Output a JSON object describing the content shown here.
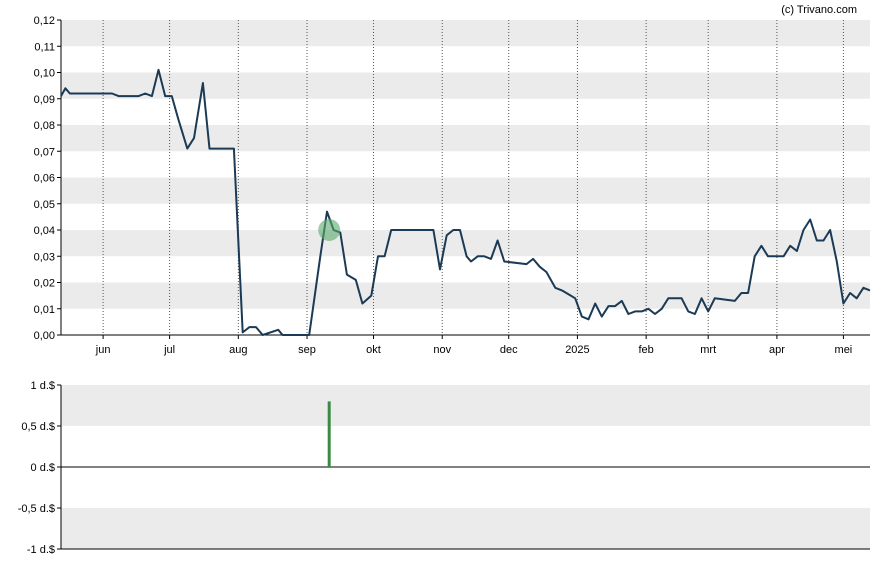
{
  "credit": "(c) Trivano.com",
  "colors": {
    "price_line": "#1b3a55",
    "band": "#ebebeb",
    "volume_bar": "#3a8a45",
    "marker_fill": "#5aaa6a",
    "axis": "#000000",
    "vgrid": "#555555"
  },
  "chart_data": [
    {
      "type": "line",
      "title": "",
      "xlabel": "",
      "ylabel": "",
      "ylim": [
        0,
        0.12
      ],
      "y_ticks": [
        "0,00",
        "0,01",
        "0,02",
        "0,03",
        "0,04",
        "0,05",
        "0,06",
        "0,07",
        "0,08",
        "0,09",
        "0,10",
        "0,11",
        "0,12"
      ],
      "x_range": [
        "2024-05-13",
        "2025-05-13"
      ],
      "x_ticks": [
        {
          "label": "jun",
          "date": "2024-06-01"
        },
        {
          "label": "jul",
          "date": "2024-07-01"
        },
        {
          "label": "aug",
          "date": "2024-08-01"
        },
        {
          "label": "sep",
          "date": "2024-09-01"
        },
        {
          "label": "okt",
          "date": "2024-10-01"
        },
        {
          "label": "nov",
          "date": "2024-11-01"
        },
        {
          "label": "dec",
          "date": "2024-12-01"
        },
        {
          "label": "2025",
          "date": "2025-01-01"
        },
        {
          "label": "feb",
          "date": "2025-02-01"
        },
        {
          "label": "mrt",
          "date": "2025-03-01"
        },
        {
          "label": "apr",
          "date": "2025-04-01"
        },
        {
          "label": "mei",
          "date": "2025-05-01"
        }
      ],
      "grid": "horizontal alternating bands, dotted vertical lines at month starts",
      "series": [
        {
          "points": [
            [
              "2024-05-13",
              0.091
            ],
            [
              "2024-05-15",
              0.094
            ],
            [
              "2024-05-17",
              0.092
            ],
            [
              "2024-05-24",
              0.092
            ],
            [
              "2024-06-05",
              0.092
            ],
            [
              "2024-06-08",
              0.091
            ],
            [
              "2024-06-17",
              0.091
            ],
            [
              "2024-06-20",
              0.092
            ],
            [
              "2024-06-23",
              0.091
            ],
            [
              "2024-06-26",
              0.101
            ],
            [
              "2024-06-29",
              0.091
            ],
            [
              "2024-07-02",
              0.091
            ],
            [
              "2024-07-05",
              0.082
            ],
            [
              "2024-07-09",
              0.071
            ],
            [
              "2024-07-12",
              0.075
            ],
            [
              "2024-07-16",
              0.096
            ],
            [
              "2024-07-19",
              0.071
            ],
            [
              "2024-07-26",
              0.071
            ],
            [
              "2024-07-30",
              0.071
            ],
            [
              "2024-08-03",
              0.001
            ],
            [
              "2024-08-06",
              0.003
            ],
            [
              "2024-08-09",
              0.003
            ],
            [
              "2024-08-12",
              0.0
            ],
            [
              "2024-08-19",
              0.002
            ],
            [
              "2024-08-21",
              0.0
            ],
            [
              "2024-08-30",
              0.0
            ],
            [
              "2024-09-02",
              0.0
            ],
            [
              "2024-09-07",
              0.03
            ],
            [
              "2024-09-10",
              0.047
            ],
            [
              "2024-09-13",
              0.04
            ],
            [
              "2024-09-16",
              0.039
            ],
            [
              "2024-09-19",
              0.023
            ],
            [
              "2024-09-23",
              0.021
            ],
            [
              "2024-09-26",
              0.012
            ],
            [
              "2024-09-30",
              0.015
            ],
            [
              "2024-10-03",
              0.03
            ],
            [
              "2024-10-06",
              0.03
            ],
            [
              "2024-10-09",
              0.04
            ],
            [
              "2024-10-28",
              0.04
            ],
            [
              "2024-10-31",
              0.025
            ],
            [
              "2024-11-03",
              0.038
            ],
            [
              "2024-11-06",
              0.04
            ],
            [
              "2024-11-09",
              0.04
            ],
            [
              "2024-11-12",
              0.03
            ],
            [
              "2024-11-14",
              0.028
            ],
            [
              "2024-11-17",
              0.03
            ],
            [
              "2024-11-20",
              0.03
            ],
            [
              "2024-11-23",
              0.029
            ],
            [
              "2024-11-26",
              0.036
            ],
            [
              "2024-11-29",
              0.028
            ],
            [
              "2024-12-09",
              0.027
            ],
            [
              "2024-12-12",
              0.029
            ],
            [
              "2024-12-15",
              0.026
            ],
            [
              "2024-12-18",
              0.024
            ],
            [
              "2024-12-22",
              0.018
            ],
            [
              "2024-12-25",
              0.017
            ],
            [
              "2024-12-29",
              0.015
            ],
            [
              "2024-12-31",
              0.014
            ],
            [
              "2025-01-03",
              0.007
            ],
            [
              "2025-01-06",
              0.006
            ],
            [
              "2025-01-09",
              0.012
            ],
            [
              "2025-01-12",
              0.007
            ],
            [
              "2025-01-15",
              0.011
            ],
            [
              "2025-01-18",
              0.011
            ],
            [
              "2025-01-21",
              0.013
            ],
            [
              "2025-01-24",
              0.008
            ],
            [
              "2025-01-27",
              0.009
            ],
            [
              "2025-01-30",
              0.009
            ],
            [
              "2025-02-02",
              0.01
            ],
            [
              "2025-02-05",
              0.008
            ],
            [
              "2025-02-08",
              0.01
            ],
            [
              "2025-02-11",
              0.014
            ],
            [
              "2025-02-14",
              0.014
            ],
            [
              "2025-02-17",
              0.014
            ],
            [
              "2025-02-20",
              0.009
            ],
            [
              "2025-02-23",
              0.008
            ],
            [
              "2025-02-26",
              0.014
            ],
            [
              "2025-03-01",
              0.009
            ],
            [
              "2025-03-04",
              0.014
            ],
            [
              "2025-03-13",
              0.013
            ],
            [
              "2025-03-16",
              0.016
            ],
            [
              "2025-03-19",
              0.016
            ],
            [
              "2025-03-22",
              0.03
            ],
            [
              "2025-03-25",
              0.034
            ],
            [
              "2025-03-28",
              0.03
            ],
            [
              "2025-04-04",
              0.03
            ],
            [
              "2025-04-07",
              0.034
            ],
            [
              "2025-04-10",
              0.032
            ],
            [
              "2025-04-13",
              0.04
            ],
            [
              "2025-04-16",
              0.044
            ],
            [
              "2025-04-19",
              0.036
            ],
            [
              "2025-04-22",
              0.036
            ],
            [
              "2025-04-25",
              0.04
            ],
            [
              "2025-04-28",
              0.028
            ],
            [
              "2025-05-01",
              0.012
            ],
            [
              "2025-05-04",
              0.016
            ],
            [
              "2025-05-07",
              0.014
            ],
            [
              "2025-05-10",
              0.018
            ],
            [
              "2025-05-13",
              0.017
            ]
          ]
        }
      ],
      "annotations": [
        {
          "type": "highlight-circle",
          "date": "2024-09-11",
          "value": 0.04
        }
      ]
    },
    {
      "type": "bar",
      "title": "",
      "xlabel": "",
      "ylabel": "",
      "ylim": [
        -1,
        1
      ],
      "y_ticks": [
        "-1 d.$",
        "-0,5 d.$",
        "0 d.$",
        "0,5 d.$",
        "1 d.$"
      ],
      "bars": [
        {
          "date": "2024-09-11",
          "value": 0.8
        }
      ]
    }
  ]
}
